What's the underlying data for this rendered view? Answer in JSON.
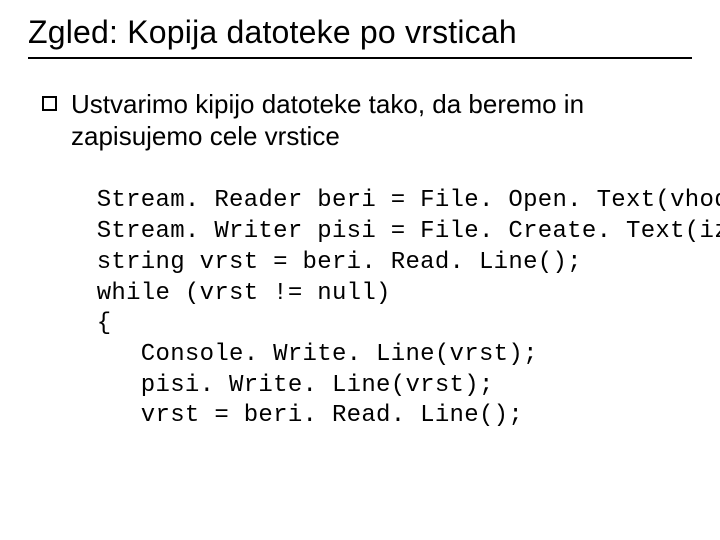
{
  "title": "Zgled: Kopija datoteke po vrsticah",
  "bullet": "Ustvarimo kipijo datoteke tako, da beremo in zapisujemo cele vrstice",
  "code": {
    "l1": " Stream. Reader beri = File. Open. Text(vhod);",
    "l2": " Stream. Writer pisi = File. Create. Text(izhod);",
    "l3": " string vrst = beri. Read. Line();",
    "l4": " while (vrst != null)",
    "l5": " {",
    "l6": "    Console. Write. Line(vrst);",
    "l7": "    pisi. Write. Line(vrst);",
    "l8": "    vrst = beri. Read. Line();"
  }
}
